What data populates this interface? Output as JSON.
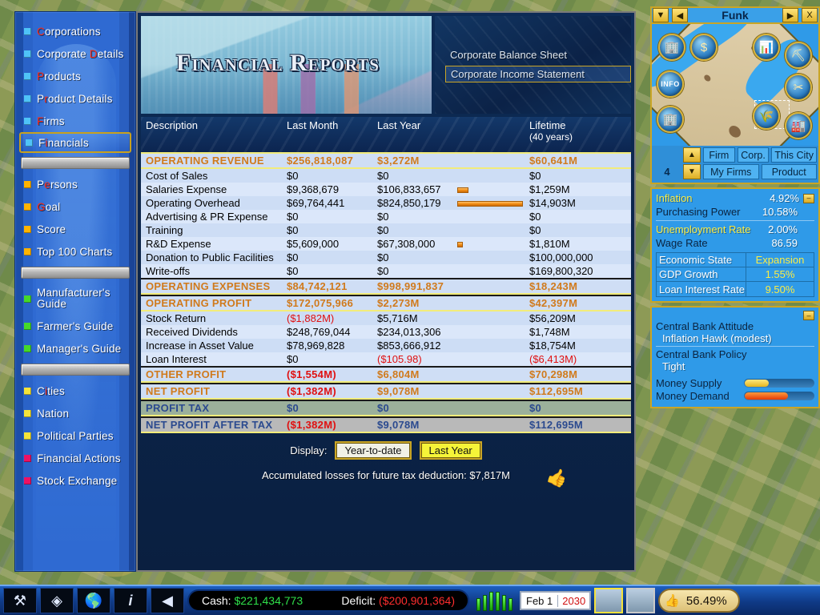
{
  "sidebar": {
    "items": [
      {
        "label": "Corporations",
        "hotkey": "C",
        "bullet": "#4fc3f7",
        "selected": false
      },
      {
        "label": "Corporate Details",
        "hotkey": "D",
        "bullet": "#4fc3f7",
        "selected": false
      },
      {
        "label": "Products",
        "hotkey": "P",
        "bullet": "#4fc3f7",
        "selected": false
      },
      {
        "label": "Product Details",
        "hotkey": "r",
        "bullet": "#4fc3f7",
        "selected": false
      },
      {
        "label": "Firms",
        "hotkey": "F",
        "bullet": "#4fc3f7",
        "selected": false
      },
      {
        "label": "Financials",
        "hotkey": "i",
        "bullet": "#4fc3f7",
        "selected": true
      },
      {
        "separator": true
      },
      {
        "label": "Persons",
        "hotkey": "e",
        "bullet": "#ffb300",
        "selected": false
      },
      {
        "label": "Goal",
        "hotkey": "G",
        "bullet": "#ffb300",
        "selected": false
      },
      {
        "label": "Score",
        "hotkey": "",
        "bullet": "#ffb300",
        "selected": false
      },
      {
        "label": "Top 100 Charts",
        "hotkey": "",
        "bullet": "#ffb300",
        "selected": false
      },
      {
        "separator": true
      },
      {
        "label": "Manufacturer's Guide",
        "hotkey": "",
        "bullet": "#46d82a",
        "selected": false,
        "two_line": true
      },
      {
        "label": "Farmer's Guide",
        "hotkey": "",
        "bullet": "#46d82a",
        "selected": false
      },
      {
        "label": "Manager's Guide",
        "hotkey": "",
        "bullet": "#46d82a",
        "selected": false
      },
      {
        "separator": true
      },
      {
        "label": "Cities",
        "hotkey": "i",
        "bullet": "#f5e33a",
        "selected": false
      },
      {
        "label": "Nation",
        "hotkey": "",
        "bullet": "#f5e33a",
        "selected": false
      },
      {
        "label": "Political Parties",
        "hotkey": "",
        "bullet": "#f5e33a",
        "selected": false
      },
      {
        "label": "Financial Actions",
        "hotkey": "",
        "bullet": "#ee1164",
        "selected": false
      },
      {
        "label": "Stock Exchange",
        "hotkey": "",
        "bullet": "#ee1164",
        "selected": false
      }
    ]
  },
  "main": {
    "banner_title": "Financial Reports",
    "report_tabs": [
      {
        "label": "Corporate Balance Sheet",
        "active": false
      },
      {
        "label": "Corporate Income Statement",
        "active": true
      }
    ],
    "columns": {
      "description": "Description",
      "last_month": "Last Month",
      "last_year": "Last Year",
      "lifetime": "Lifetime",
      "lifetime_sub": "(40 years)"
    },
    "rows": [
      {
        "kind": "section",
        "variant": "first",
        "desc": "OPERATING REVENUE",
        "last_month": "$256,818,087",
        "last_year": "$3,272M",
        "lifetime": "$60,641M"
      },
      {
        "kind": "item",
        "desc": "Cost of Sales",
        "last_month": "$0",
        "last_year": "$0",
        "lifetime": "$0"
      },
      {
        "kind": "item",
        "desc": "Salaries Expense",
        "last_month": "$9,368,679",
        "last_year": "$106,833,657",
        "lifetime": "$1,259M",
        "bar": 14
      },
      {
        "kind": "item",
        "desc": "Operating Overhead",
        "last_month": "$69,764,441",
        "last_year": "$824,850,179",
        "lifetime": "$14,903M",
        "bar": 82
      },
      {
        "kind": "item",
        "desc": "Advertising & PR Expense",
        "last_month": "$0",
        "last_year": "$0",
        "lifetime": "$0"
      },
      {
        "kind": "item",
        "desc": "Training",
        "last_month": "$0",
        "last_year": "$0",
        "lifetime": "$0"
      },
      {
        "kind": "item",
        "desc": "R&D Expense",
        "last_month": "$5,609,000",
        "last_year": "$67,308,000",
        "lifetime": "$1,810M",
        "bar": 7
      },
      {
        "kind": "item",
        "desc": "Donation to Public Facilities",
        "last_month": "$0",
        "last_year": "$0",
        "lifetime": "$100,000,000"
      },
      {
        "kind": "item",
        "desc": "Write-offs",
        "last_month": "$0",
        "last_year": "$0",
        "lifetime": "$169,800,320"
      },
      {
        "kind": "section",
        "desc": "OPERATING EXPENSES",
        "last_month": "$84,742,121",
        "last_year": "$998,991,837",
        "lifetime": "$18,243M"
      },
      {
        "kind": "section",
        "desc": "OPERATING PROFIT",
        "last_month": "$172,075,966",
        "last_year": "$2,273M",
        "lifetime": "$42,397M"
      },
      {
        "kind": "item",
        "desc": "Stock Return",
        "last_month": "($1,882M)",
        "last_year": "$5,716M",
        "lifetime": "$56,209M",
        "neg_lm": true
      },
      {
        "kind": "item",
        "desc": "Received Dividends",
        "last_month": "$248,769,044",
        "last_year": "$234,013,306",
        "lifetime": "$1,748M"
      },
      {
        "kind": "item",
        "desc": "Increase in Asset Value",
        "last_month": "$78,969,828",
        "last_year": "$853,666,912",
        "lifetime": "$18,754M"
      },
      {
        "kind": "item",
        "desc": "Loan Interest",
        "last_month": "$0",
        "last_year": "($105.98)",
        "lifetime": "($6,413M)",
        "neg_ly": true,
        "neg_lt": true
      },
      {
        "kind": "section",
        "desc": "OTHER PROFIT",
        "last_month": "($1,554M)",
        "last_year": "$6,804M",
        "lifetime": "$70,298M",
        "neg_lm": true
      },
      {
        "kind": "section",
        "desc": "NET PROFIT",
        "last_month": "($1,382M)",
        "last_year": "$9,078M",
        "lifetime": "$112,695M",
        "neg_lm": true
      },
      {
        "kind": "section",
        "variant": "tax",
        "desc": "PROFIT TAX",
        "last_month": "$0",
        "last_year": "$0",
        "lifetime": "$0"
      },
      {
        "kind": "section",
        "variant": "after",
        "desc": "NET PROFIT AFTER TAX",
        "last_month": "($1,382M)",
        "last_year": "$9,078M",
        "lifetime": "$112,695M",
        "neg_lm": true
      }
    ],
    "footer": {
      "display_label": "Display:",
      "btn_ytd": "Year-to-date",
      "btn_last_year": "Last Year",
      "accumulated": "Accumulated losses for future tax deduction: $7,817M"
    }
  },
  "right_panel": {
    "window_title": "Funk",
    "titlebar_buttons": [
      "▼",
      "◀",
      "▶",
      "X"
    ],
    "minimap": {
      "orbs": [
        {
          "name": "city-icon",
          "glyph": "🏢"
        },
        {
          "name": "money-icon",
          "glyph": "$"
        },
        {
          "name": "chart-icon",
          "glyph": "📊"
        },
        {
          "name": "mine-icon",
          "glyph": "⛏"
        },
        {
          "name": "info-icon",
          "glyph": "INFO"
        },
        {
          "name": "tools-icon",
          "glyph": "✂"
        },
        {
          "name": "building-icon",
          "glyph": "🏢"
        },
        {
          "name": "farm-icon",
          "glyph": "🌾"
        },
        {
          "name": "factory-icon",
          "glyph": "🏭"
        }
      ]
    },
    "nav": {
      "count": "4",
      "up": "▲",
      "down": "▼",
      "buttons_row1": [
        "Firm",
        "Corp.",
        "This City"
      ],
      "buttons_row2": [
        "My Firms",
        "Product"
      ]
    },
    "economy": {
      "inflation_label": "Inflation",
      "inflation_value": "4.92%",
      "purchasing_label": "Purchasing Power",
      "purchasing_value": "10.58%",
      "unemployment_label": "Unemployment Rate",
      "unemployment_value": "2.00%",
      "wage_label": "Wage Rate",
      "wage_value": "86.59",
      "state_label": "Economic State",
      "state_value": "Expansion",
      "gdp_label": "GDP Growth",
      "gdp_value": "1.55%",
      "loan_label": "Loan Interest Rate",
      "loan_value": "9.50%",
      "collapse_glyph": "–"
    },
    "bank": {
      "attitude_label": "Central Bank Attitude",
      "attitude_value": "Inflation Hawk (modest)",
      "policy_label": "Central Bank Policy",
      "policy_value": "Tight",
      "money_supply_label": "Money Supply",
      "money_supply_pct": 34,
      "money_demand_label": "Money Demand",
      "money_demand_pct": 61
    }
  },
  "bottom_bar": {
    "tools": [
      {
        "name": "build-tools-icon",
        "glyph": "⚒"
      },
      {
        "name": "map-grid-icon",
        "glyph": "◈"
      },
      {
        "name": "world-map-icon",
        "glyph": "🌎"
      },
      {
        "name": "info-icon",
        "glyph": "i"
      },
      {
        "name": "back-icon",
        "glyph": "◀"
      }
    ],
    "cash_label": "Cash:",
    "cash_value": "$221,434,773",
    "deficit_label": "Deficit:",
    "deficit_value": "($200,901,364)",
    "speed_bars": 6,
    "date_day": "Feb 1",
    "date_year": "2030",
    "approval_value": "56.49%",
    "approval_icon": "👍"
  },
  "colors": {
    "accent_gold": "#c9a526",
    "section_orange": "#d07a1c",
    "negative_red": "#e01010",
    "cash_green": "#2fe04a",
    "panel_blue": "#2f9ae8"
  }
}
